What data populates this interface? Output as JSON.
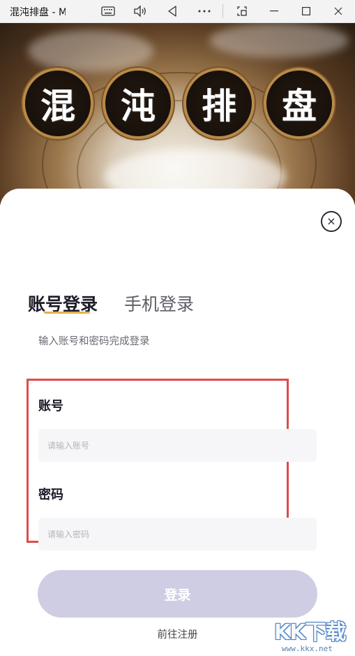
{
  "window": {
    "title": "混沌排盘 - M",
    "buttons": [
      "keyboard-icon",
      "speaker-icon",
      "back-icon",
      "more-icon",
      "snip-icon",
      "minimize-icon",
      "maximize-icon",
      "close-icon"
    ]
  },
  "hero": {
    "characters": [
      "混",
      "沌",
      "排",
      "盘"
    ]
  },
  "login": {
    "close_symbol": "×",
    "tabs": [
      {
        "label": "账号登录",
        "active": true
      },
      {
        "label": "手机登录",
        "active": false
      }
    ],
    "subtitle": "输入账号和密码完成登录",
    "account_label": "账号",
    "account_placeholder": "请输入账号",
    "account_value": "",
    "password_label": "密码",
    "password_placeholder": "请输入密码",
    "password_value": "",
    "submit_label": "登录",
    "register_link": "前往注册"
  },
  "watermark": {
    "text": "KK下载",
    "url": "www.kkx.net"
  },
  "colors": {
    "tab_underline": "#e0b24e",
    "login_button": "#cfcde3",
    "highlight_box": "#e04b4b",
    "medallion_ring": "#b88a4a"
  }
}
